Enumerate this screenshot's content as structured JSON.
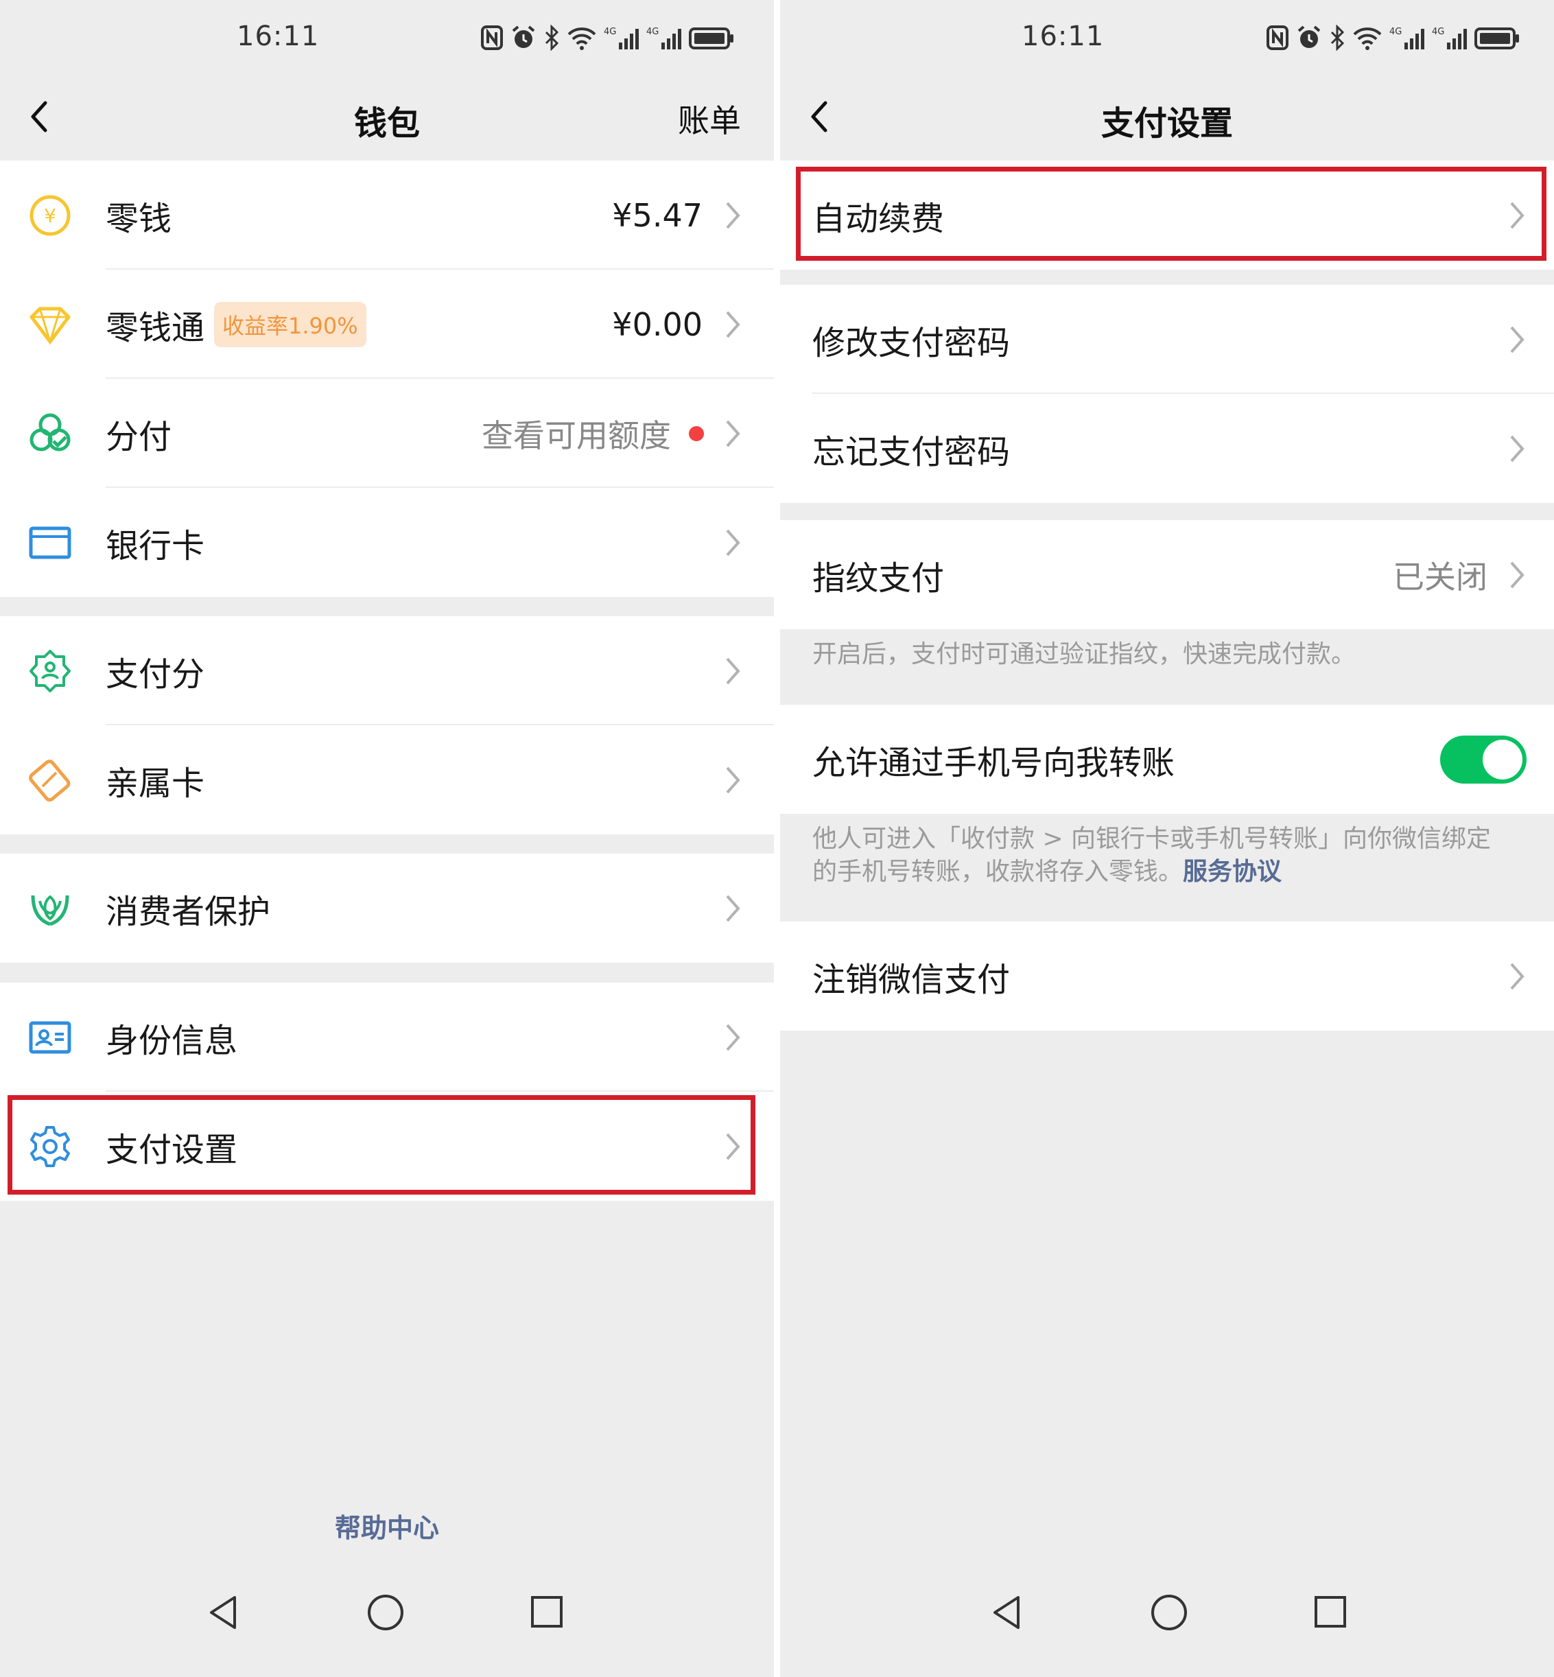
{
  "status_bar": {
    "time": "16:11"
  },
  "wallet": {
    "nav": {
      "title": "钱包",
      "action": "账单"
    },
    "items": [
      {
        "label": "零钱",
        "value": "¥5.47"
      },
      {
        "label": "零钱通",
        "badge": "收益率1.90%",
        "value": "¥0.00"
      },
      {
        "label": "分付",
        "value": "查看可用额度"
      },
      {
        "label": "银行卡"
      },
      {
        "label": "支付分"
      },
      {
        "label": "亲属卡"
      },
      {
        "label": "消费者保护"
      },
      {
        "label": "身份信息"
      },
      {
        "label": "支付设置"
      }
    ],
    "help": "帮助中心"
  },
  "pay_settings": {
    "nav": {
      "title": "支付设置"
    },
    "items": [
      {
        "label": "自动续费"
      },
      {
        "label": "修改支付密码"
      },
      {
        "label": "忘记支付密码"
      },
      {
        "label": "指纹支付",
        "value": "已关闭"
      },
      {
        "label": "允许通过手机号向我转账",
        "toggle": true
      },
      {
        "label": "注销微信支付"
      }
    ],
    "fingerprint_note": "开启后，支付时可通过验证指纹，快速完成付款。",
    "transfer_note": "他人可进入「收付款 > 向银行卡或手机号转账」向你微信绑定的手机号转账，收款将存入零钱。",
    "transfer_note_link": "服务协议"
  },
  "colors": {
    "highlight": "#d21e2a",
    "toggle_on": "#07c160",
    "link": "#576b95",
    "badge_bg": "#fde4cd",
    "badge_text": "#f0963c"
  },
  "icons": [
    "back-icon",
    "coin-yuan-icon",
    "diamond-icon",
    "split-pay-icon",
    "bank-card-icon",
    "pay-score-icon",
    "family-card-icon",
    "consumer-protection-icon",
    "id-card-icon",
    "gear-icon",
    "chevron-right-icon"
  ]
}
